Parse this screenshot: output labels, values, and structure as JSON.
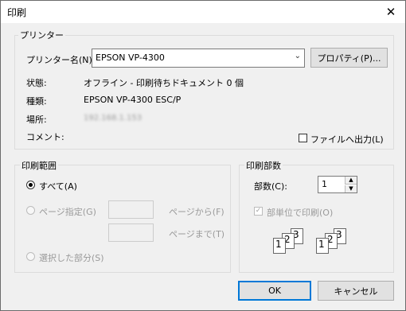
{
  "window": {
    "title": "印刷",
    "close_glyph": "✕"
  },
  "printer_group": {
    "label": "プリンター",
    "name_label": "プリンター名(N):",
    "selected_printer": "EPSON VP-4300",
    "properties_button": "プロパティ(P)...",
    "status_label": "状態:",
    "status_value": "オフライン - 印刷待ちドキュメント 0 個",
    "type_label": "種類:",
    "type_value": "EPSON VP-4300 ESC/P",
    "where_label": "場所:",
    "where_value": "192.168.1.153",
    "comment_label": "コメント:",
    "print_to_file_label": "ファイルへ出力(L)"
  },
  "range_group": {
    "label": "印刷範囲",
    "all_label": "すべて(A)",
    "pages_label": "ページ指定(G)",
    "from_label": "ページから(F)",
    "to_label": "ページまで(T)",
    "selection_label": "選択した部分(S)"
  },
  "copies_group": {
    "label": "印刷部数",
    "copies_label": "部数(C):",
    "copies_value": "1",
    "collate_label": "部単位で印刷(O)",
    "collate_numbers": [
      "1",
      "2",
      "3"
    ]
  },
  "buttons": {
    "ok": "OK",
    "cancel": "キャンセル"
  }
}
